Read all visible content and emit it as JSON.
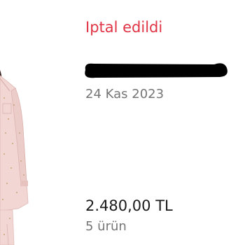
{
  "order": {
    "status": "Iptal edildi",
    "date": "24 Kas 2023",
    "price": "2.480,00 TL",
    "item_count": "5 ürün"
  },
  "colors": {
    "status_cancelled": "#e03445",
    "secondary_text": "#757575",
    "primary_text": "#1a1a1a"
  },
  "icons": {
    "product": "product-thumbnail-pajama"
  }
}
